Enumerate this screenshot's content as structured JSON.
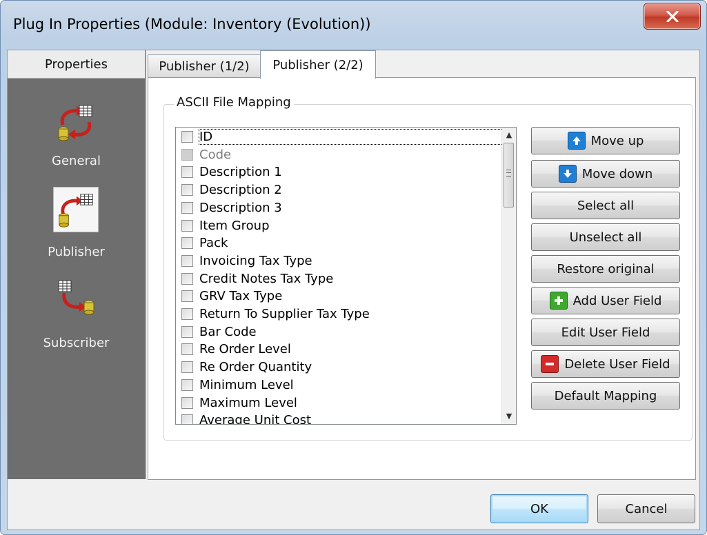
{
  "window": {
    "title": "Plug In Properties (Module: Inventory (Evolution))",
    "close_icon": "close-icon"
  },
  "left_panel": {
    "header": "Properties",
    "items": [
      {
        "label": "General",
        "icon": "general-icon"
      },
      {
        "label": "Publisher",
        "icon": "publisher-icon",
        "selected": true
      },
      {
        "label": "Subscriber",
        "icon": "subscriber-icon"
      }
    ]
  },
  "tabs": [
    {
      "label": "Publisher (1/2)",
      "active": false
    },
    {
      "label": "Publisher (2/2)",
      "active": true
    }
  ],
  "group": {
    "label": "ASCII File Mapping"
  },
  "list": {
    "items": [
      {
        "label": "ID",
        "checked": false,
        "disabled": false,
        "focused": true
      },
      {
        "label": "Code",
        "checked": false,
        "disabled": true
      },
      {
        "label": "Description 1",
        "checked": false,
        "disabled": false
      },
      {
        "label": "Description 2",
        "checked": false,
        "disabled": false
      },
      {
        "label": "Description 3",
        "checked": false,
        "disabled": false
      },
      {
        "label": "Item Group",
        "checked": false,
        "disabled": false
      },
      {
        "label": "Pack",
        "checked": false,
        "disabled": false
      },
      {
        "label": "Invoicing Tax Type",
        "checked": false,
        "disabled": false
      },
      {
        "label": "Credit Notes Tax Type",
        "checked": false,
        "disabled": false
      },
      {
        "label": "GRV Tax Type",
        "checked": false,
        "disabled": false
      },
      {
        "label": "Return To Supplier Tax Type",
        "checked": false,
        "disabled": false
      },
      {
        "label": "Bar Code",
        "checked": false,
        "disabled": false
      },
      {
        "label": "Re Order Level",
        "checked": false,
        "disabled": false
      },
      {
        "label": "Re Order Quantity",
        "checked": false,
        "disabled": false
      },
      {
        "label": "Minimum Level",
        "checked": false,
        "disabled": false
      },
      {
        "label": "Maximum Level",
        "checked": false,
        "disabled": false
      },
      {
        "label": "Average Unit Cost",
        "checked": false,
        "disabled": false
      }
    ]
  },
  "buttons": {
    "move_up": "Move up",
    "move_down": "Move down",
    "select_all": "Select all",
    "unselect_all": "Unselect all",
    "restore_original": "Restore original",
    "add_user_field": "Add User Field",
    "edit_user_field": "Edit User Field",
    "delete_user_field": "Delete User Field",
    "default_mapping": "Default Mapping",
    "ok": "OK",
    "cancel": "Cancel"
  },
  "colors": {
    "move_icon": "#1e7fd4",
    "add_icon": "#3ea82f",
    "delete_icon": "#d32a2a",
    "left_panel_bg": "#6e6e6e"
  }
}
